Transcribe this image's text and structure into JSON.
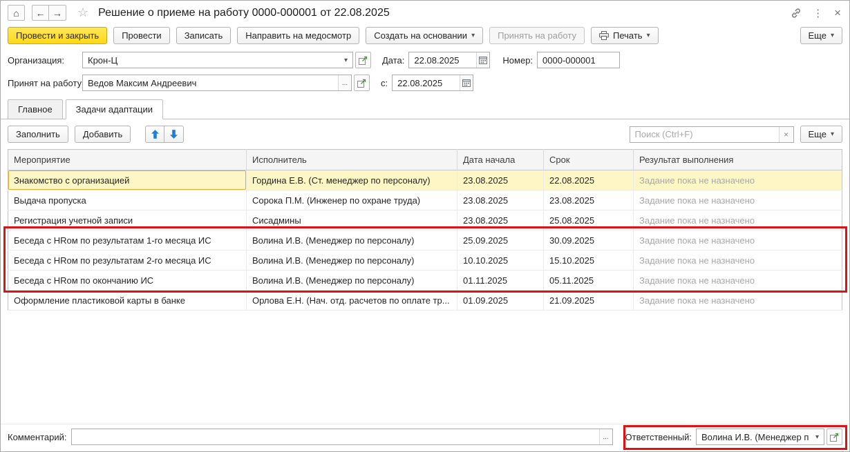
{
  "icons": {
    "home": "⌂",
    "back": "←",
    "forward": "→",
    "star": "☆",
    "kebab": "⋮",
    "close": "×",
    "caret": "▾",
    "ellipsis": "...",
    "clear": "×"
  },
  "titlebar": {
    "title": "Решение о приеме на работу 0000-000001 от 22.08.2025"
  },
  "toolbar": {
    "post_and_close": "Провести и закрыть",
    "post": "Провести",
    "write": "Записать",
    "send_medical": "Направить на медосмотр",
    "create_based_on": "Создать на основании",
    "hire": "Принять на работу",
    "print": "Печать",
    "more": "Еще"
  },
  "form": {
    "organization_label": "Организация:",
    "organization_value": "Крон-Ц",
    "date_label": "Дата:",
    "date_value": "22.08.2025",
    "number_label": "Номер:",
    "number_value": "0000-000001",
    "hired_label": "Принят на работу:",
    "hired_value": "Ведов Максим Андреевич",
    "from_label": "с:",
    "from_value": "22.08.2025"
  },
  "tabs": {
    "main": "Главное",
    "adaptation": "Задачи адаптации"
  },
  "table_toolbar": {
    "fill": "Заполнить",
    "add": "Добавить",
    "search_placeholder": "Поиск (Ctrl+F)",
    "more": "Еще"
  },
  "table": {
    "columns": [
      "Мероприятие",
      "Исполнитель",
      "Дата начала",
      "Срок",
      "Результат выполнения"
    ],
    "rows": [
      {
        "activity": "Знакомство с организацией",
        "executor": "Гордина Е.В. (Ст. менеджер по персоналу)",
        "start_date": "23.08.2025",
        "due_date": "22.08.2025",
        "result": "Задание пока не назначено"
      },
      {
        "activity": "Выдача пропуска",
        "executor": "Сорока П.М. (Инженер по охране труда)",
        "start_date": "23.08.2025",
        "due_date": "23.08.2025",
        "result": "Задание пока не назначено"
      },
      {
        "activity": "Регистрация учетной записи",
        "executor": "Сисадмины",
        "start_date": "23.08.2025",
        "due_date": "25.08.2025",
        "result": "Задание пока не назначено"
      },
      {
        "activity": "Беседа с HRом по результатам 1-го месяца ИС",
        "executor": "Волина И.В. (Менеджер по персоналу)",
        "start_date": "25.09.2025",
        "due_date": "30.09.2025",
        "result": "Задание пока не назначено"
      },
      {
        "activity": "Беседа с HRом по результатам 2-го месяца ИС",
        "executor": "Волина И.В. (Менеджер по персоналу)",
        "start_date": "10.10.2025",
        "due_date": "15.10.2025",
        "result": "Задание пока не назначено"
      },
      {
        "activity": "Беседа с HRом по окончанию ИС",
        "executor": "Волина И.В. (Менеджер по персоналу)",
        "start_date": "01.11.2025",
        "due_date": "05.11.2025",
        "result": "Задание пока не назначено"
      },
      {
        "activity": "Оформление пластиковой карты в банке",
        "executor": "Орлова Е.Н. (Нач. отд. расчетов по оплате тр...",
        "start_date": "01.09.2025",
        "due_date": "21.09.2025",
        "result": "Задание пока не назначено"
      }
    ]
  },
  "footer": {
    "comment_label": "Комментарий:",
    "comment_value": "",
    "responsible_label": "Ответственный:",
    "responsible_value": "Волина И.В. (Менеджер п"
  }
}
